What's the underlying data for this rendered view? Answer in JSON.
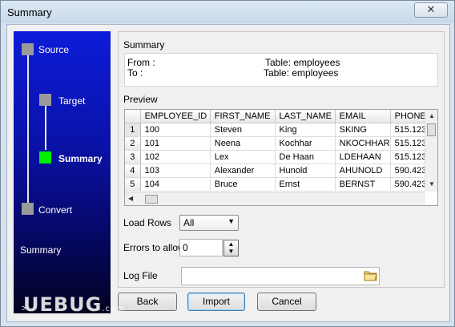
{
  "window": {
    "title": "Summary"
  },
  "steps": {
    "items": [
      {
        "label": "Source"
      },
      {
        "label": "Target"
      },
      {
        "label": "Summary"
      },
      {
        "label": "Convert"
      }
    ],
    "caption": "Summary",
    "indicator": ">"
  },
  "summary": {
    "label": "Summary",
    "from_label": "From :",
    "to_label": "To :",
    "from_table": "Table: employees",
    "to_table": "Table: employees"
  },
  "preview": {
    "label": "Preview",
    "columns": [
      "EMPLOYEE_ID",
      "FIRST_NAME",
      "LAST_NAME",
      "EMAIL",
      "PHONE_"
    ],
    "rows": [
      {
        "num": "1",
        "cells": [
          "100",
          "Steven",
          "King",
          "SKING",
          "515.123"
        ]
      },
      {
        "num": "2",
        "cells": [
          "101",
          "Neena",
          "Kochhar",
          "NKOCHHAR",
          "515.123"
        ]
      },
      {
        "num": "3",
        "cells": [
          "102",
          "Lex",
          "De Haan",
          "LDEHAAN",
          "515.123"
        ]
      },
      {
        "num": "4",
        "cells": [
          "103",
          "Alexander",
          "Hunold",
          "AHUNOLD",
          "590.423"
        ]
      },
      {
        "num": "5",
        "cells": [
          "104",
          "Bruce",
          "Ernst",
          "BERNST",
          "590.423"
        ]
      }
    ]
  },
  "options": {
    "load_rows_label": "Load Rows",
    "load_rows_value": "All",
    "errors_label": "Errors to allow",
    "errors_value": "0",
    "log_file_label": "Log File",
    "log_file_value": ""
  },
  "buttons": {
    "back": "Back",
    "import": "Import",
    "cancel": "Cancel"
  },
  "watermark": {
    "text": "UEBUG",
    "suffix": ".com"
  },
  "colors": {
    "active_step": "#00ee00",
    "inactive_step": "#9a9a9a"
  }
}
